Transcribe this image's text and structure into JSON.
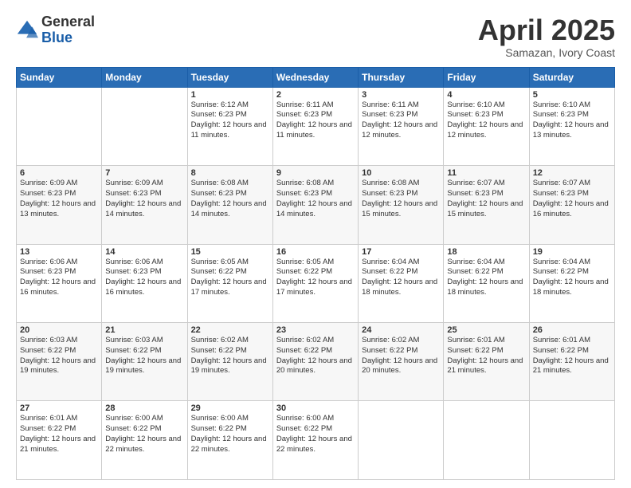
{
  "logo": {
    "general": "General",
    "blue": "Blue"
  },
  "header": {
    "title": "April 2025",
    "subtitle": "Samazan, Ivory Coast"
  },
  "weekdays": [
    "Sunday",
    "Monday",
    "Tuesday",
    "Wednesday",
    "Thursday",
    "Friday",
    "Saturday"
  ],
  "weeks": [
    [
      {
        "day": "",
        "info": ""
      },
      {
        "day": "",
        "info": ""
      },
      {
        "day": "1",
        "info": "Sunrise: 6:12 AM\nSunset: 6:23 PM\nDaylight: 12 hours and 11 minutes."
      },
      {
        "day": "2",
        "info": "Sunrise: 6:11 AM\nSunset: 6:23 PM\nDaylight: 12 hours and 11 minutes."
      },
      {
        "day": "3",
        "info": "Sunrise: 6:11 AM\nSunset: 6:23 PM\nDaylight: 12 hours and 12 minutes."
      },
      {
        "day": "4",
        "info": "Sunrise: 6:10 AM\nSunset: 6:23 PM\nDaylight: 12 hours and 12 minutes."
      },
      {
        "day": "5",
        "info": "Sunrise: 6:10 AM\nSunset: 6:23 PM\nDaylight: 12 hours and 13 minutes."
      }
    ],
    [
      {
        "day": "6",
        "info": "Sunrise: 6:09 AM\nSunset: 6:23 PM\nDaylight: 12 hours and 13 minutes."
      },
      {
        "day": "7",
        "info": "Sunrise: 6:09 AM\nSunset: 6:23 PM\nDaylight: 12 hours and 14 minutes."
      },
      {
        "day": "8",
        "info": "Sunrise: 6:08 AM\nSunset: 6:23 PM\nDaylight: 12 hours and 14 minutes."
      },
      {
        "day": "9",
        "info": "Sunrise: 6:08 AM\nSunset: 6:23 PM\nDaylight: 12 hours and 14 minutes."
      },
      {
        "day": "10",
        "info": "Sunrise: 6:08 AM\nSunset: 6:23 PM\nDaylight: 12 hours and 15 minutes."
      },
      {
        "day": "11",
        "info": "Sunrise: 6:07 AM\nSunset: 6:23 PM\nDaylight: 12 hours and 15 minutes."
      },
      {
        "day": "12",
        "info": "Sunrise: 6:07 AM\nSunset: 6:23 PM\nDaylight: 12 hours and 16 minutes."
      }
    ],
    [
      {
        "day": "13",
        "info": "Sunrise: 6:06 AM\nSunset: 6:23 PM\nDaylight: 12 hours and 16 minutes."
      },
      {
        "day": "14",
        "info": "Sunrise: 6:06 AM\nSunset: 6:23 PM\nDaylight: 12 hours and 16 minutes."
      },
      {
        "day": "15",
        "info": "Sunrise: 6:05 AM\nSunset: 6:22 PM\nDaylight: 12 hours and 17 minutes."
      },
      {
        "day": "16",
        "info": "Sunrise: 6:05 AM\nSunset: 6:22 PM\nDaylight: 12 hours and 17 minutes."
      },
      {
        "day": "17",
        "info": "Sunrise: 6:04 AM\nSunset: 6:22 PM\nDaylight: 12 hours and 18 minutes."
      },
      {
        "day": "18",
        "info": "Sunrise: 6:04 AM\nSunset: 6:22 PM\nDaylight: 12 hours and 18 minutes."
      },
      {
        "day": "19",
        "info": "Sunrise: 6:04 AM\nSunset: 6:22 PM\nDaylight: 12 hours and 18 minutes."
      }
    ],
    [
      {
        "day": "20",
        "info": "Sunrise: 6:03 AM\nSunset: 6:22 PM\nDaylight: 12 hours and 19 minutes."
      },
      {
        "day": "21",
        "info": "Sunrise: 6:03 AM\nSunset: 6:22 PM\nDaylight: 12 hours and 19 minutes."
      },
      {
        "day": "22",
        "info": "Sunrise: 6:02 AM\nSunset: 6:22 PM\nDaylight: 12 hours and 19 minutes."
      },
      {
        "day": "23",
        "info": "Sunrise: 6:02 AM\nSunset: 6:22 PM\nDaylight: 12 hours and 20 minutes."
      },
      {
        "day": "24",
        "info": "Sunrise: 6:02 AM\nSunset: 6:22 PM\nDaylight: 12 hours and 20 minutes."
      },
      {
        "day": "25",
        "info": "Sunrise: 6:01 AM\nSunset: 6:22 PM\nDaylight: 12 hours and 21 minutes."
      },
      {
        "day": "26",
        "info": "Sunrise: 6:01 AM\nSunset: 6:22 PM\nDaylight: 12 hours and 21 minutes."
      }
    ],
    [
      {
        "day": "27",
        "info": "Sunrise: 6:01 AM\nSunset: 6:22 PM\nDaylight: 12 hours and 21 minutes."
      },
      {
        "day": "28",
        "info": "Sunrise: 6:00 AM\nSunset: 6:22 PM\nDaylight: 12 hours and 22 minutes."
      },
      {
        "day": "29",
        "info": "Sunrise: 6:00 AM\nSunset: 6:22 PM\nDaylight: 12 hours and 22 minutes."
      },
      {
        "day": "30",
        "info": "Sunrise: 6:00 AM\nSunset: 6:22 PM\nDaylight: 12 hours and 22 minutes."
      },
      {
        "day": "",
        "info": ""
      },
      {
        "day": "",
        "info": ""
      },
      {
        "day": "",
        "info": ""
      }
    ]
  ]
}
